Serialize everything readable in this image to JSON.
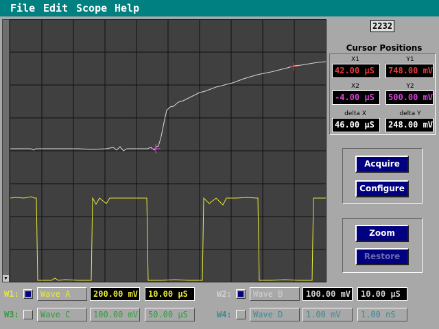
{
  "menu": {
    "items": [
      "File",
      "Edit",
      "Scope",
      "Help"
    ]
  },
  "counter": "2232",
  "cursor_panel": {
    "title": "Cursor Positions",
    "x1_label": "X1",
    "x1_value": "42.00 µS",
    "y1_label": "Y1",
    "y1_value": "748.00 mV",
    "x2_label": "X2",
    "x2_value": "-4.00 µS",
    "y2_label": "Y2",
    "y2_value": "500.00 mV",
    "dx_label": "delta X",
    "dx_value": "46.00 µS",
    "dy_label": "delta Y",
    "dy_value": "248.00 mV"
  },
  "buttons": {
    "acquire": "Acquire",
    "configure": "Configure",
    "zoom": "Zoom",
    "restore": "Restore"
  },
  "waves": [
    {
      "label": "W1:",
      "name": "Wave A",
      "volts": "200.00 mV",
      "time": "10.00 µS",
      "checked": true,
      "color": "#e8e83c"
    },
    {
      "label": "W2:",
      "name": "Wave B",
      "volts": "100.00 mV",
      "time": "10.00 µS",
      "checked": true,
      "color": "#d0d0d0"
    },
    {
      "label": "W3:",
      "name": "Wave C",
      "volts": "100.00 mV",
      "time": "50.00 µS",
      "checked": false,
      "color": "#2e9e3c"
    },
    {
      "label": "W4:",
      "name": "Wave D",
      "volts": "1.00 mV",
      "time": "1.00 nS",
      "checked": false,
      "color": "#3c8a96"
    }
  ],
  "colors": {
    "menubar": "#008080",
    "screen": "#404040",
    "grid": "#101010",
    "trace_white": "#d8d8d8",
    "trace_yellow": "#e8e83c",
    "cursor_red": "#e83c3c",
    "cursor_magenta": "#e040e0",
    "button": "#000080"
  },
  "icons": {
    "scroll_down": "down-arrow-icon"
  }
}
